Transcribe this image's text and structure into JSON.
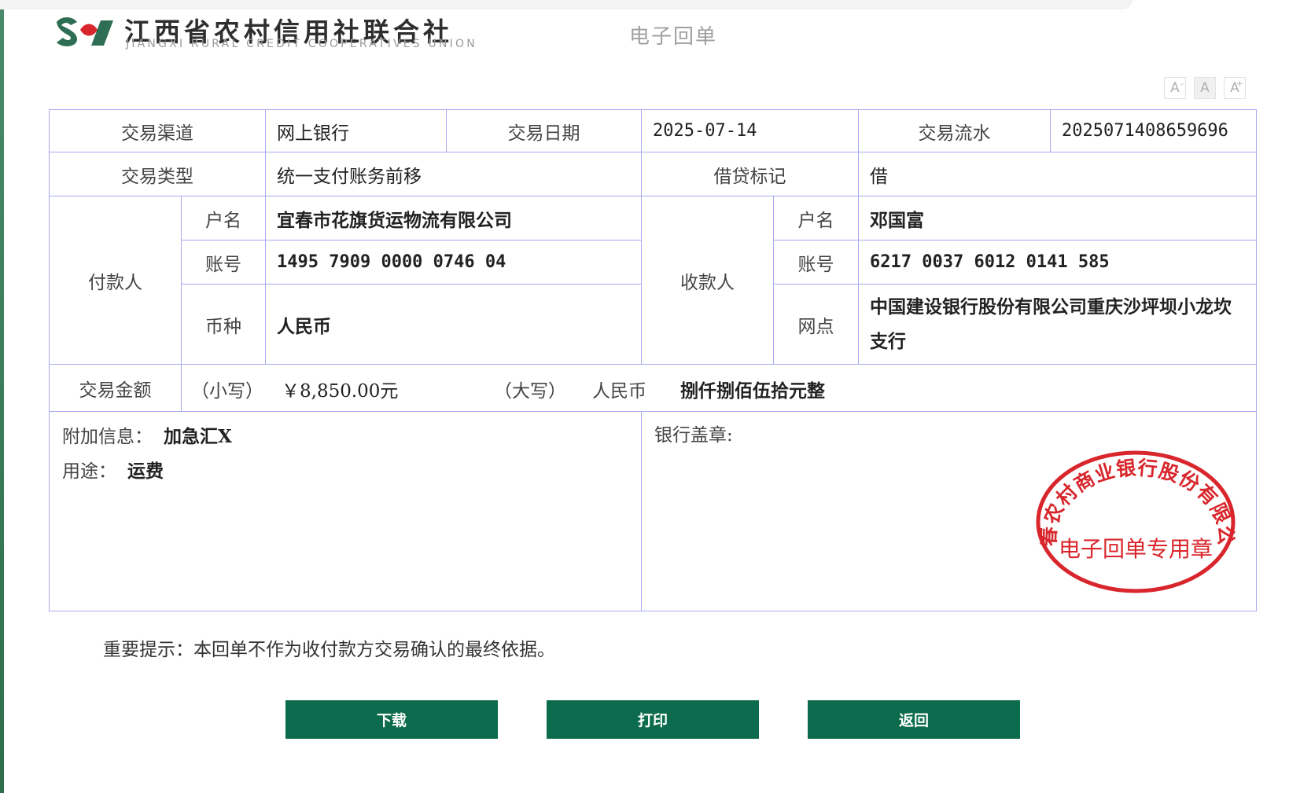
{
  "header": {
    "brand_cn": "江西省农村信用社联合社",
    "brand_en": "JIANGXI RURAL CREDIT COOPERATIVES UNION",
    "doc_title": "电子回单",
    "logo_icon": "jx-rcc-logo-icon"
  },
  "font_tools": {
    "decrease": "A",
    "normal": "A",
    "increase": "A",
    "decrease_mark": "-",
    "increase_mark": "+"
  },
  "receipt": {
    "channel_label": "交易渠道",
    "channel": "网上银行",
    "date_label": "交易日期",
    "date": "2025-07-14",
    "serial_label": "交易流水",
    "serial": "2025071408659696",
    "type_label": "交易类型",
    "type": "统一支付账务前移",
    "dc_label": "借贷标记",
    "dc": "借",
    "payer_label": "付款人",
    "payer_name_label": "户名",
    "payer_name": "宜春市花旗货运物流有限公司",
    "payer_acct_label": "账号",
    "payer_acct": "1495 7909 0000 0746 04",
    "payer_currency_label": "币种",
    "payer_currency": "人民币",
    "payee_label": "收款人",
    "payee_name_label": "户名",
    "payee_name": "邓国富",
    "payee_acct_label": "账号",
    "payee_acct": "6217 0037 6012 0141 585",
    "payee_branch_label": "网点",
    "payee_branch": "中国建设银行股份有限公司重庆沙坪坝小龙坎支行",
    "amount_label": "交易金额",
    "amount_small_label": "（小写）",
    "amount_small": "￥8,850.00元",
    "amount_big_label": "（大写）",
    "amount_big_currency": "人民币",
    "amount_big": "捌仟捌佰伍拾元整",
    "extra_label": "附加信息：",
    "extra": "加急汇X",
    "purpose_label": "用途：",
    "purpose": "运费",
    "stamp_label": "银行盖章:",
    "stamp_org": "宜春农村商业银行股份有限公司",
    "stamp_use": "电子回单专用章",
    "stamp_color": "#d8262c"
  },
  "notice": "重要提示：本回单不作为收付款方交易确认的最终依据。",
  "buttons": {
    "download": "下载",
    "print": "打印",
    "back": "返回"
  },
  "colors": {
    "primary": "#0b6b4c",
    "border": "#a9a9f0"
  }
}
